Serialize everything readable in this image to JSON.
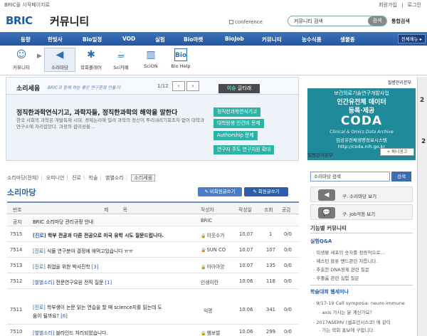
{
  "util": {
    "left": "BRIC을 시작페이지로",
    "join": "회원가입",
    "sep": "|",
    "login": "로그인"
  },
  "header": {
    "logo": "BRIC",
    "title": "커뮤니티",
    "conference": "conference",
    "search_value": "커뮤니티 검색",
    "search_btn": "검색",
    "total_search": "통합검색"
  },
  "gnb": {
    "items": [
      "동향",
      "한빛사",
      "Bio일정",
      "VOD",
      "실험",
      "Bio마켓",
      "BioJob",
      "커뮤니티",
      "농수식품",
      "생물종"
    ],
    "all_menu": "전체메뉴 ▸"
  },
  "subnav": {
    "items": [
      {
        "label": "커뮤니티",
        "icon": "people-icon"
      },
      {
        "label": "소리마당",
        "icon": "megaphone-icon"
      },
      {
        "label": "학회플레어",
        "icon": "flare-icon"
      },
      {
        "label": "Sci카페",
        "icon": "cafe-icon"
      },
      {
        "label": "SciON",
        "icon": "chart-icon"
      },
      {
        "label": "Bio Help",
        "icon": "bio-icon"
      }
    ],
    "arrow": "▶"
  },
  "sori": {
    "title": "소리세움",
    "subtitle": "BRIC과 함께 하는 좋은 연구문화 만들기!",
    "page": "1/12",
    "prev": "‹",
    "next": "›",
    "issue_a": "이슈",
    "issue_b": "글타래",
    "headline": "정직한과학연식기고, 과학자들, 정직한과학의 해악을 말한다",
    "body": "한국 사회의 과학은 개발독재 시대, 경제논리에 밀려 과학의 정신이 뿌리내리기회조차 없이 대학과 연구소에 자리잡았다. 과정의 합리성을…",
    "tags": [
      "정직한과학연식기고",
      "대학원생 인건비 문제",
      "Authorship 문제",
      "연구자 주도 연구지원 확대"
    ]
  },
  "banner": {
    "top": "질병관리본부",
    "l1": "보건의료기술연구개발사업",
    "l2": "인간유전체 데이터",
    "l3": "등록·제공",
    "coda": "CODA",
    "l5": "Clinical & Omics Data Archive",
    "l6": "임상유전체생명정보시스템",
    "l7": "http://coda.nih.go.kr",
    "caption": "질병관리본부",
    "more": "+ 배너광고",
    "edge1": "2",
    "edge2": "2"
  },
  "side": {
    "search_value": "소리마당 검색",
    "search_btn": "검색",
    "link1": "구. 소리마당 보기",
    "link2": "구. Job걱정 보기",
    "board_head": "기능별 커뮤니티",
    "qa_title": "실험Q&A",
    "qa_items": [
      "미생물 세포의 숫자를 정량적으로…",
      "웨스턴 블롯 밴드관련 자릅니다.",
      "추출한 DNA정제 관련 질문",
      "후졸룸 관련 실험 질문"
    ],
    "conf_title": "학술대회 웹세미나",
    "conf_items": [
      "9/17-19 Cell symposia: neuro-immune",
      "axis 가시는 분 계신가요?",
      "2017ASEMV (셀프런시스코) 에 같이",
      "가는 학회 홍보에 구합니다."
    ]
  },
  "board": {
    "cats": [
      "소리마당(전체)",
      "오피니언",
      "진로",
      "학술",
      "별별소리",
      "소리세움"
    ],
    "title": "소리마당",
    "btn_non": "✎ 비회원글쓰기",
    "btn_mem": "✎ 회원글쓰기",
    "headers": {
      "num": "번호",
      "subject": "제　　　목",
      "author": "작성자",
      "date": "작성일",
      "views": "조회",
      "likes": "공감"
    },
    "rows": [
      {
        "num": "공지",
        "tag": "",
        "subject": "BRIC 소리마당 관리규정 안내",
        "cnt": "",
        "author": "BRIC",
        "date": "",
        "views": "",
        "likes": "",
        "lock": false
      },
      {
        "num": "7515",
        "tag": "[진로]",
        "subject": " 학부 전공과 다른 전공으로 미국 유학 시도 질문드립니다.",
        "cnt": "",
        "author": "이웃수가",
        "date": "10.07",
        "views": "1",
        "likes": "0/0",
        "lock": true
      },
      {
        "num": "7514",
        "tag": "[진로]",
        "subject": " 식물 연구분야 결정에 애먹고있습니다 ㅠㅠ",
        "cnt": "",
        "author": "SUN CO",
        "date": "10.07",
        "views": "107",
        "likes": "0/0",
        "lock": true
      },
      {
        "num": "7513",
        "tag": "[진로]",
        "subject": " 취업을 위한 박사진학",
        "cnt": " [3]",
        "author": "아아아앙",
        "date": "10.07",
        "views": "135",
        "likes": "0/0",
        "lock": true
      },
      {
        "num": "7512",
        "tag": "[별별소리]",
        "subject": " 전문연구요원 전직 질문",
        "cnt": " [1]",
        "author": "인생이란",
        "date": "10.06",
        "views": "118",
        "likes": "0/0",
        "lock": false
      },
      {
        "num": "7511",
        "tag": "[진로]",
        "subject": " 학부생이 논문 읽는 연습을 할 때 science지를 읽는데 도",
        "subject2": "움이 될까요?",
        "cnt": " [6]",
        "author": "익명",
        "date": "10.06",
        "views": "341",
        "likes": "0/0",
        "lock": false
      },
      {
        "num": "7510",
        "tag": "[별별소리]",
        "subject": " 블라인드 처리되었습니다.",
        "cnt": "",
        "author": "햄보벌",
        "date": "10.06",
        "views": "299",
        "likes": "0/0",
        "lock": true
      }
    ]
  }
}
